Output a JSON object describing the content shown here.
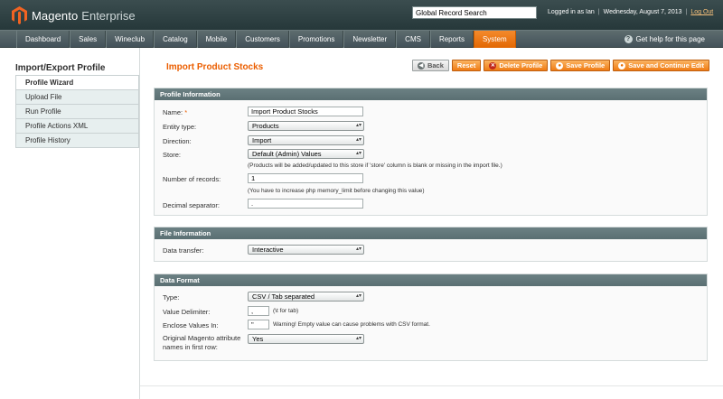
{
  "header": {
    "brand": "Magento",
    "edition": "Enterprise",
    "search_value": "Global Record Search",
    "logged_in": "Logged in as Ian",
    "date": "Wednesday, August 7, 2013",
    "logout": "Log Out"
  },
  "nav": {
    "items": [
      "Dashboard",
      "Sales",
      "Wineclub",
      "Catalog",
      "Mobile",
      "Customers",
      "Promotions",
      "Newsletter",
      "CMS",
      "Reports",
      "System"
    ],
    "active": "System",
    "help": "Get help for this page"
  },
  "sidebar": {
    "title": "Import/Export Profile",
    "tabs": [
      "Profile Wizard",
      "Upload File",
      "Run Profile",
      "Profile Actions XML",
      "Profile History"
    ]
  },
  "page": {
    "title": "Import Product Stocks",
    "buttons": {
      "back": "Back",
      "reset": "Reset",
      "delete": "Delete Profile",
      "save": "Save Profile",
      "save_continue": "Save and Continue Edit"
    }
  },
  "profile_info": {
    "heading": "Profile Information",
    "name_label": "Name:",
    "name_required": "*",
    "name_value": "Import Product Stocks",
    "entity_label": "Entity type:",
    "entity_value": "Products",
    "direction_label": "Direction:",
    "direction_value": "Import",
    "store_label": "Store:",
    "store_value": "Default (Admin) Values",
    "store_note": "(Products will be added/updated to this store if 'store' column is blank or missing in the import file.)",
    "records_label": "Number of records:",
    "records_value": "1",
    "records_note": "(You have to increase php memory_limit before changing this value)",
    "decimal_label": "Decimal separator:",
    "decimal_value": "."
  },
  "file_info": {
    "heading": "File Information",
    "transfer_label": "Data transfer:",
    "transfer_value": "Interactive"
  },
  "data_format": {
    "heading": "Data Format",
    "type_label": "Type:",
    "type_value": "CSV / Tab separated",
    "delimiter_label": "Value Delimiter:",
    "delimiter_value": ",",
    "delimiter_note": "(\\t for tab)",
    "enclose_label": "Enclose Values In:",
    "enclose_value": "\"",
    "enclose_note": "Warning! Empty value can cause problems with CSV format.",
    "original_label_1": "Original Magento attribute",
    "original_label_2": "names in first row:",
    "original_value": "Yes"
  },
  "colors": {
    "accent": "#eb5e00",
    "header_bg": "#2f4143",
    "fieldset_head": "#607578"
  }
}
